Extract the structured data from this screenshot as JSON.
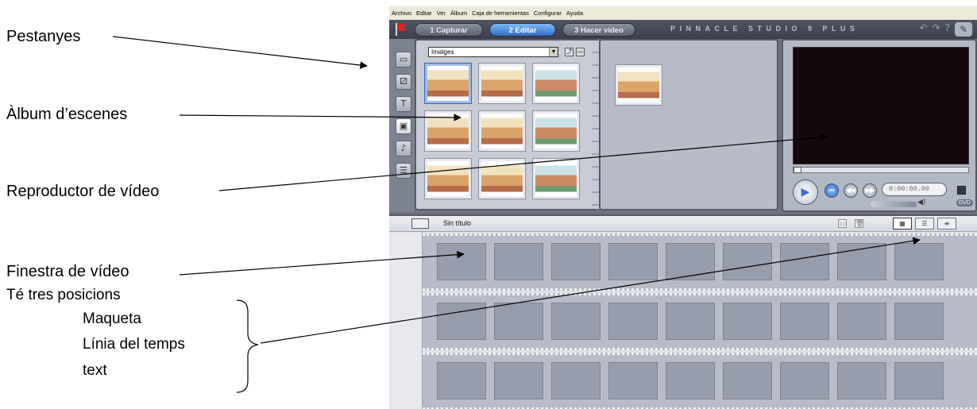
{
  "annotations": {
    "pestanyes": "Pestanyes",
    "album": "Àlbum d’escenes",
    "reproductor": "Reproductor de vídeo",
    "finestra": "Finestra de vídeo",
    "te_tres_posicions": "Té tres posicions",
    "posicions": [
      "Maqueta",
      "Línia del temps",
      "text"
    ]
  },
  "menubar": [
    "Archivo",
    "Editar",
    "Ver",
    "Álbum",
    "Caja de herramientas",
    "Configurar",
    "Ayuda"
  ],
  "tabs": [
    "1 Capturar",
    "2 Editar",
    "3 Hacer vídeo"
  ],
  "brand": "PINNACLE STUDIO 9 PLUS",
  "album_select": "Imatges",
  "player": {
    "timecode": "0:00:00.00",
    "dvd": "DVD"
  },
  "movie": {
    "title": "Sin título"
  },
  "colors": {
    "active_tab": "#2f6fcc",
    "screen": "#15080f",
    "storyboard_cell": "#989dae"
  }
}
